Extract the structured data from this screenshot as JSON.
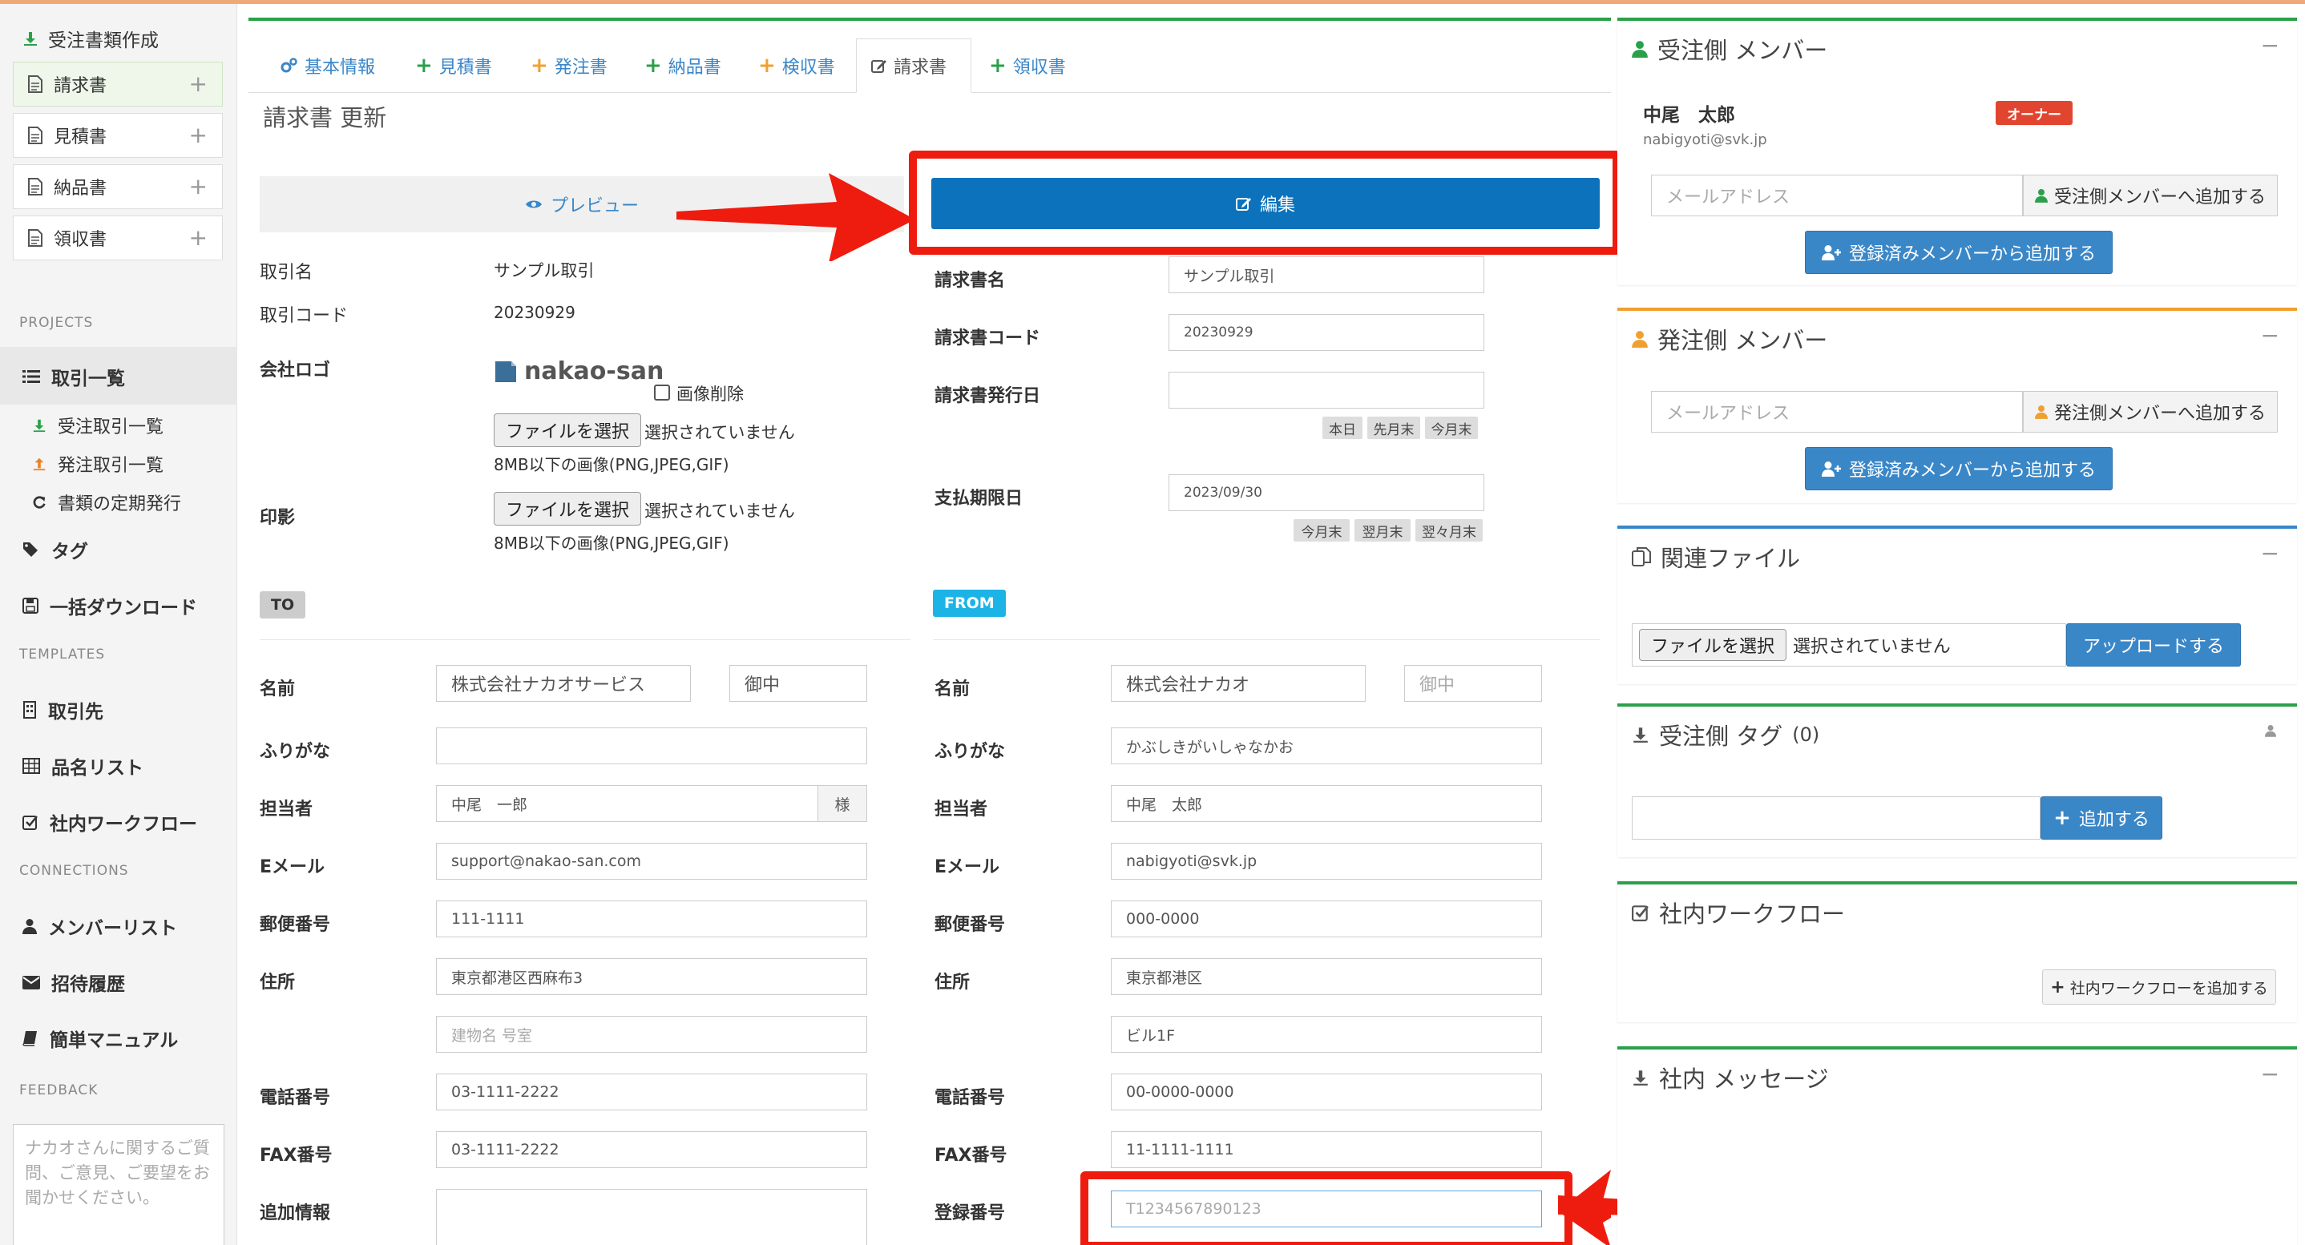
{
  "sidebar": {
    "title": "受注書類作成",
    "docs": [
      {
        "label": "請求書",
        "icon": "document-icon",
        "active": true
      },
      {
        "label": "見積書",
        "icon": "document-icon",
        "active": false
      },
      {
        "label": "納品書",
        "icon": "document-icon",
        "active": false
      },
      {
        "label": "領収書",
        "icon": "document-icon",
        "active": false
      }
    ],
    "sections": {
      "projects": "PROJECTS",
      "templates": "TEMPLATES",
      "connections": "CONNECTIONS",
      "feedback": "FEEDBACK"
    },
    "nav": {
      "deals": "取引一覧",
      "received_deals": "受注取引一覧",
      "ordered_deals": "発注取引一覧",
      "periodic": "書類の定期発行",
      "tags": "タグ",
      "bulk_download": "一括ダウンロード",
      "clients": "取引先",
      "items": "品名リスト",
      "workflow": "社内ワークフロー",
      "members": "メンバーリスト",
      "invites": "招待履歴",
      "manual": "簡単マニュアル"
    },
    "feedback_placeholder": "ナカオさんに関するご質問、ご意見、ご要望をお聞かせください。"
  },
  "tabs": [
    {
      "label": "基本情報",
      "icon": "gears-icon",
      "color": "#3a86c8"
    },
    {
      "label": "見積書",
      "icon": "plus-icon",
      "color": "#2aa04a"
    },
    {
      "label": "発注書",
      "icon": "plus-icon",
      "color": "#f0a030"
    },
    {
      "label": "納品書",
      "icon": "plus-icon",
      "color": "#2aa04a"
    },
    {
      "label": "検収書",
      "icon": "plus-icon",
      "color": "#f0a030"
    },
    {
      "label": "請求書",
      "icon": "edit-icon",
      "color": "#555555",
      "active": true
    },
    {
      "label": "領収書",
      "icon": "plus-icon",
      "color": "#2aa04a"
    }
  ],
  "form": {
    "title": "請求書 更新",
    "preview_label": "プレビュー",
    "edit_label": "編集",
    "left": {
      "deal_name_label": "取引名",
      "deal_name": "サンプル取引",
      "deal_code_label": "取引コード",
      "deal_code": "20230929",
      "logo_label": "会社ロゴ",
      "logo_text": "nakao-san",
      "delete_image": "画像削除",
      "file_button": "ファイルを選択",
      "no_file": "選択されていません",
      "size_hint": "8MB以下の画像(PNG,JPEG,GIF)",
      "seal_label": "印影"
    },
    "right": {
      "invoice_name_label": "請求書名",
      "invoice_name": "サンプル取引",
      "invoice_code_label": "請求書コード",
      "invoice_code": "20230929",
      "issue_date_label": "請求書発行日",
      "issue_date": "",
      "issue_buttons": [
        "本日",
        "先月末",
        "今月末"
      ],
      "due_label": "支払期限日",
      "due_date": "2023/09/30",
      "due_buttons": [
        "今月末",
        "翌月末",
        "翌々月末"
      ]
    },
    "to_badge": "TO",
    "from_badge": "FROM",
    "labels": {
      "name": "名前",
      "kana": "ふりがな",
      "person": "担当者",
      "email": "Eメール",
      "zip": "郵便番号",
      "address": "住所",
      "tel": "電話番号",
      "fax": "FAX番号",
      "extra": "追加情報",
      "reg_no": "登録番号"
    },
    "to": {
      "name": "株式会社ナカオサービス",
      "honorific": "御中",
      "kana": "",
      "person": "中尾　一郎",
      "person_suffix": "様",
      "email": "support@nakao-san.com",
      "zip": "111-1111",
      "address": "東京都港区西麻布3",
      "building_placeholder": "建物名 号室",
      "tel": "03-1111-2222",
      "fax": "03-1111-2222",
      "extra": ""
    },
    "from": {
      "name": "株式会社ナカオ",
      "honorific_placeholder": "御中",
      "kana": "かぶしきがいしゃなかお",
      "person": "中尾　太郎",
      "email": "nabigyoti@svk.jp",
      "zip": "000-0000",
      "address": "東京都港区",
      "building": "ビル1F",
      "tel": "00-0000-0000",
      "fax": "11-1111-1111",
      "reg_no_placeholder": "T1234567890123"
    }
  },
  "panels": {
    "receiver_members": {
      "title": "受注側 メンバー",
      "member_name": "中尾　太郎",
      "member_badge": "オーナー",
      "member_email": "nabigyoti@svk.jp",
      "email_placeholder": "メールアドレス",
      "add_button": "受注側メンバーへ追加する",
      "registered_button": "登録済みメンバーから追加する"
    },
    "orderer_members": {
      "title": "発注側 メンバー",
      "email_placeholder": "メールアドレス",
      "add_button": "発注側メンバーへ追加する",
      "registered_button": "登録済みメンバーから追加する"
    },
    "files": {
      "title": "関連ファイル",
      "file_button": "ファイルを選択",
      "no_file": "選択されていません",
      "upload": "アップロードする"
    },
    "tags": {
      "title": "受注側 タグ",
      "count": "(0)",
      "add": "追加する"
    },
    "workflow": {
      "title": "社内ワークフロー",
      "add": "社内ワークフローを追加する"
    },
    "messages": {
      "title": "社内 メッセージ"
    },
    "minus": "−"
  },
  "colors": {
    "accent_green": "#2aa04a",
    "accent_orange": "#f0a030",
    "accent_blue": "#3a86c8",
    "primary_button": "#0b72bb",
    "badge_red": "#e2452f",
    "badge_cyan": "#1cb4e6",
    "annotation_red": "#ee1c0f"
  }
}
